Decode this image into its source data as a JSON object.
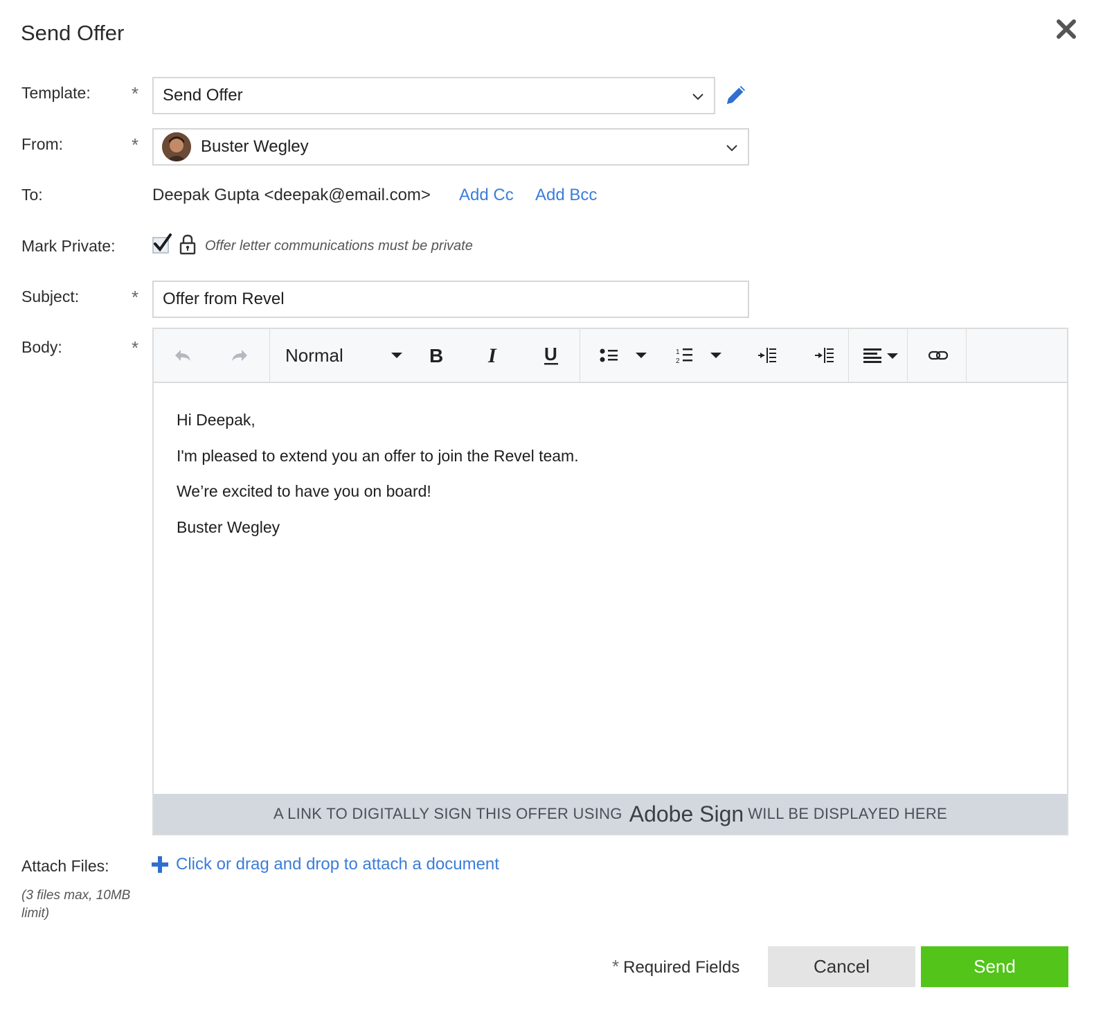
{
  "dialog": {
    "title": "Send Offer"
  },
  "form": {
    "template": {
      "label": "Template:",
      "value": "Send Offer"
    },
    "from": {
      "label": "From:",
      "value": "Buster Wegley"
    },
    "to": {
      "label": "To:",
      "value": "Deepak Gupta <deepak@email.com>",
      "add_cc": "Add Cc",
      "add_bcc": "Add Bcc"
    },
    "mark_private": {
      "label": "Mark Private:",
      "checked": true,
      "note": "Offer letter communications must be private"
    },
    "subject": {
      "label": "Subject:",
      "value": "Offer from Revel"
    },
    "body": {
      "label": "Body:",
      "toolbar": {
        "style_select": "Normal"
      },
      "lines": [
        "Hi Deepak,",
        "I'm pleased to extend you an offer to join the Revel team.",
        "We’re excited to have you on board!",
        "Buster Wegley"
      ],
      "sign_banner": {
        "before": "A LINK TO DIGITALLY SIGN THIS OFFER USING",
        "brand": "Adobe Sign",
        "after": "WILL BE DISPLAYED HERE"
      }
    },
    "attach": {
      "label": "Attach Files:",
      "hint": "(3 files max, 10MB limit)",
      "link": "Click or drag and drop to attach a document"
    },
    "required_marker": "*"
  },
  "footer": {
    "required_note": "Required Fields",
    "cancel": "Cancel",
    "send": "Send"
  },
  "colors": {
    "link": "#3b7dd8",
    "send_button": "#52c41a",
    "cancel_button": "#e4e4e4",
    "sign_banner": "#d3d8df"
  }
}
